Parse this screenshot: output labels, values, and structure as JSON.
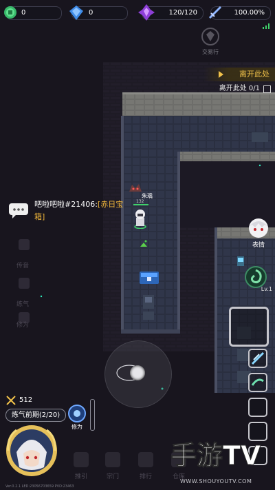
{
  "resources": {
    "gold": "0",
    "gem": "0",
    "stamina": "120/120",
    "power_percent": "100.00%"
  },
  "trade_shop_label": "交易行",
  "quest": {
    "title": "离开此处",
    "objective": "离开此处 0/1"
  },
  "characters": {
    "ally_name": "朱瑀",
    "ally_hp": "132"
  },
  "chat": {
    "sender": "吧啦吧啦#21406:",
    "item_open": "[赤日宝",
    "item_close": "箱]"
  },
  "emote_label": "表情",
  "skill": {
    "level": "Lv.1"
  },
  "side_menu_ghost": [
    "传音",
    "练气",
    "修为"
  ],
  "player": {
    "power": "512",
    "realm": "炼气前期(2/20)",
    "cultivate_label": "修为"
  },
  "bottom_nav": [
    {
      "label": "推引"
    },
    {
      "label": "宗门"
    },
    {
      "label": "排行"
    },
    {
      "label": "仓库"
    }
  ],
  "watermark": {
    "logo_text": "手游TV",
    "url": "WWW.SHOUYOUTV.COM"
  },
  "version": "Ver.0.2.1    LED:23056703659    PVD:23463",
  "colors": {
    "accent_gold": "#f1c24a",
    "chat_highlight": "#f1b73a",
    "hp_green": "#3fd26a"
  }
}
